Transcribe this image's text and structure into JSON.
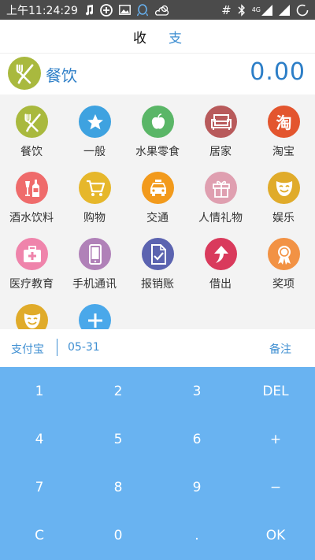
{
  "status": {
    "time": "上午11:24:29",
    "signal": "4G"
  },
  "type_tabs": {
    "income": "收",
    "expense": "支"
  },
  "selected": {
    "label": "餐饮",
    "amount": "0.00"
  },
  "categories": [
    {
      "label": "餐饮",
      "color": "#a9b93e",
      "icon": "utensils-icon"
    },
    {
      "label": "一般",
      "color": "#3ea2e0",
      "icon": "star-icon"
    },
    {
      "label": "水果零食",
      "color": "#5ab667",
      "icon": "apple-icon"
    },
    {
      "label": "居家",
      "color": "#b85a5b",
      "icon": "sofa-icon"
    },
    {
      "label": "淘宝",
      "color": "#e3552e",
      "icon": "taobao-icon",
      "glyph": "淘"
    },
    {
      "label": "酒水饮料",
      "color": "#ef6b6b",
      "icon": "wine-bottle-icon"
    },
    {
      "label": "购物",
      "color": "#e6b72b",
      "icon": "shopping-cart-icon"
    },
    {
      "label": "交通",
      "color": "#f29a1c",
      "icon": "taxi-icon"
    },
    {
      "label": "人情礼物",
      "color": "#df9fb0",
      "icon": "gift-icon"
    },
    {
      "label": "娱乐",
      "color": "#e0ab2a",
      "icon": "mask-icon"
    },
    {
      "label": "医疗教育",
      "color": "#ef84ab",
      "icon": "medical-kit-icon"
    },
    {
      "label": "手机通讯",
      "color": "#b081b8",
      "icon": "phone-icon"
    },
    {
      "label": "报销账",
      "color": "#5b63b0",
      "icon": "document-check-icon"
    },
    {
      "label": "借出",
      "color": "#d93a5c",
      "icon": "arrow-up-icon"
    },
    {
      "label": "奖项",
      "color": "#f29244",
      "icon": "medal-icon"
    },
    {
      "label": "",
      "color": "#e0ab2a",
      "icon": "mask-icon"
    },
    {
      "label": "",
      "color": "#4aa8ea",
      "icon": "plus-icon"
    }
  ],
  "info": {
    "account": "支付宝",
    "date": "05-31",
    "note": "备注"
  },
  "keys": [
    "1",
    "2",
    "3",
    "DEL",
    "4",
    "5",
    "6",
    "+",
    "7",
    "8",
    "9",
    "−",
    "C",
    "0",
    ".",
    "OK"
  ]
}
